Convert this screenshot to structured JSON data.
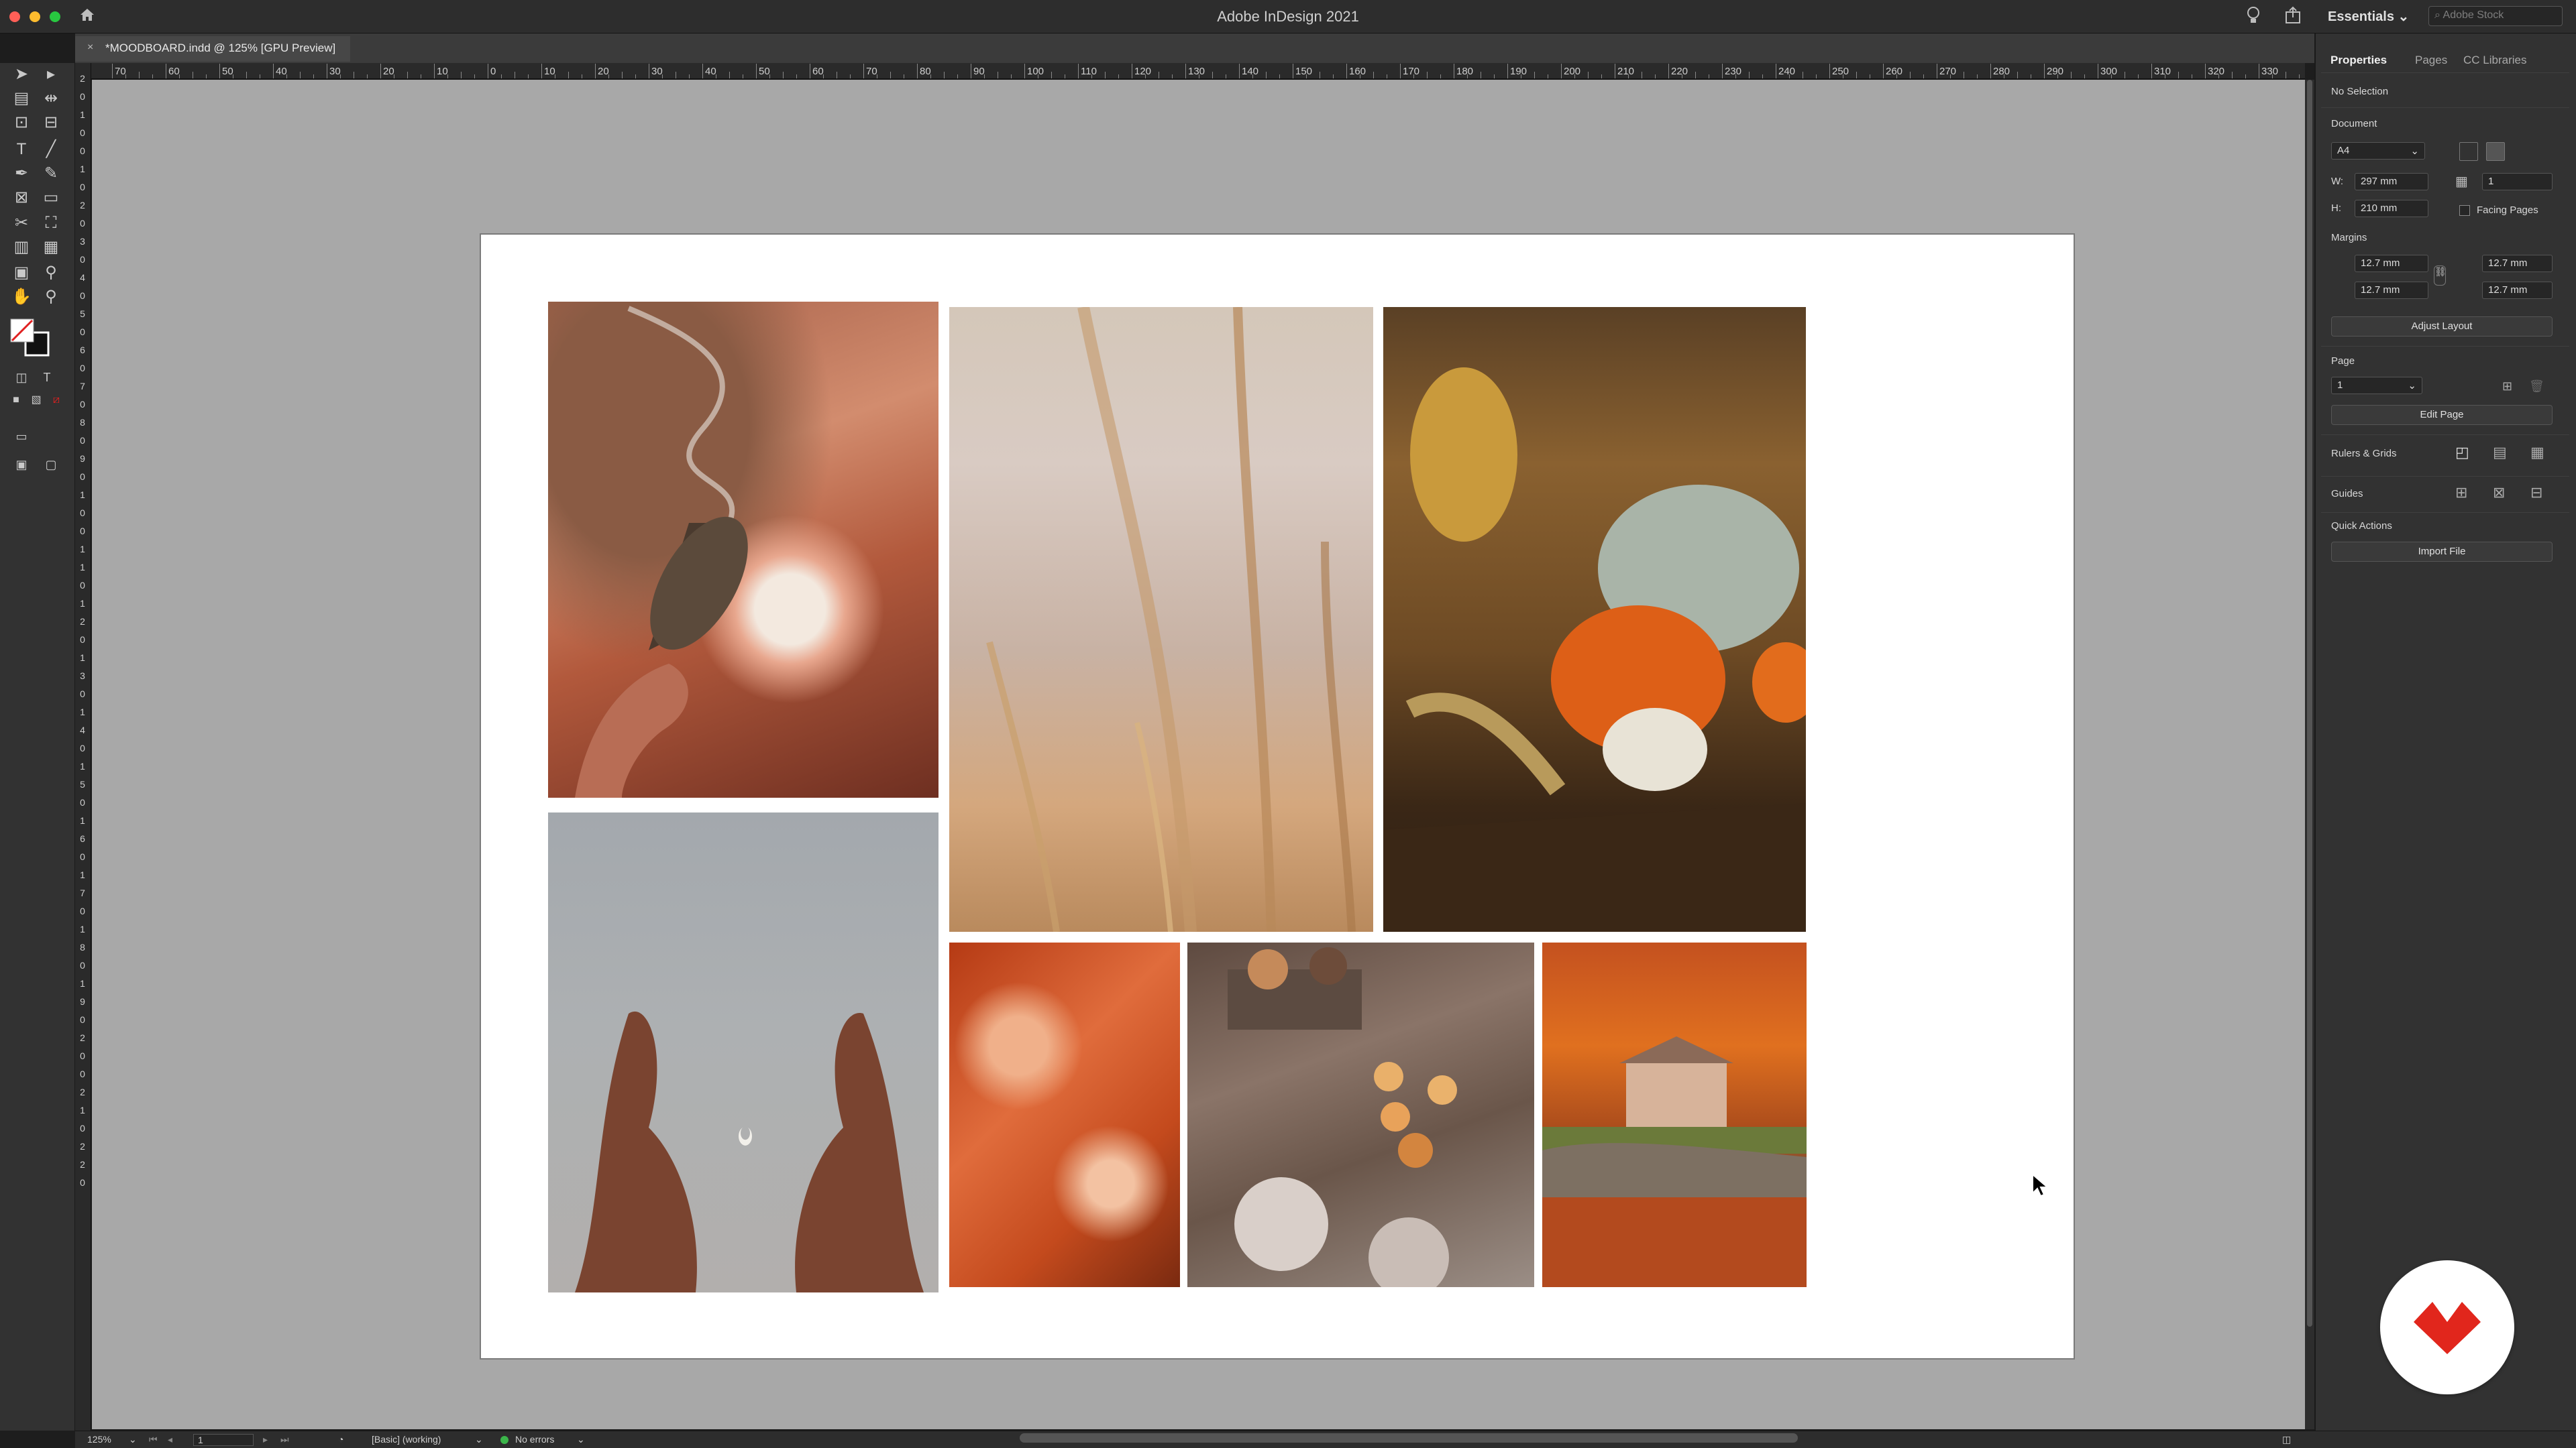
{
  "window": {
    "app_title": "Adobe InDesign 2021",
    "workspace": "Essentials",
    "stock_search_placeholder": "Adobe Stock"
  },
  "document_tab": {
    "close_glyph": "×",
    "label": "*MOODBOARD.indd @ 125% [GPU Preview]"
  },
  "ruler_horizontal": [
    "70",
    "60",
    "50",
    "40",
    "30",
    "20",
    "10",
    "0",
    "10",
    "20",
    "30",
    "40",
    "50",
    "60",
    "70",
    "80",
    "90",
    "100",
    "110",
    "120",
    "130",
    "140",
    "150",
    "160",
    "170",
    "180",
    "190",
    "200",
    "210",
    "220",
    "230",
    "240",
    "250",
    "260",
    "270",
    "280",
    "290",
    "300",
    "310",
    "320",
    "330"
  ],
  "ruler_vertical": [
    "2",
    "0",
    "1",
    "0",
    "0",
    "1",
    "0",
    "2",
    "0",
    "3",
    "0",
    "4",
    "0",
    "5",
    "0",
    "6",
    "0",
    "7",
    "0",
    "8",
    "0",
    "9",
    "0",
    "1",
    "0",
    "0",
    "1",
    "1",
    "0",
    "1",
    "2",
    "0",
    "1",
    "3",
    "0",
    "1",
    "4",
    "0",
    "1",
    "5",
    "0",
    "1",
    "6",
    "0",
    "1",
    "7",
    "0",
    "1",
    "8",
    "0",
    "1",
    "9",
    "0",
    "2",
    "0",
    "0",
    "2",
    "1",
    "0",
    "2",
    "2",
    "0"
  ],
  "moodboard": {
    "photos": [
      {
        "name": "photo-sage-smudge",
        "subject": "hand holding smoking sage bundle"
      },
      {
        "name": "photo-wheat-grass",
        "subject": "soft focus dry grass"
      },
      {
        "name": "photo-pumpkins",
        "subject": "pumpkins and autumn leaves"
      },
      {
        "name": "photo-hands-moon",
        "subject": "hands framing crescent moon"
      },
      {
        "name": "photo-autumn-leaves",
        "subject": "orange autumn leaves"
      },
      {
        "name": "photo-candles",
        "subject": "candles on books with cotton"
      },
      {
        "name": "photo-house-autumn",
        "subject": "house behind autumn trees"
      }
    ],
    "swatches": [
      "#c2c6a7",
      "#9fa07c",
      "#9a620f",
      "#dd6a15",
      "#e6a64d"
    ]
  },
  "properties_panel": {
    "tabs": [
      "Properties",
      "Pages",
      "CC Libraries"
    ],
    "selection_status": "No Selection",
    "document_section": "Document",
    "page_size": "A4",
    "width_label": "W:",
    "width_value": "297 mm",
    "height_label": "H:",
    "height_value": "210 mm",
    "pages_count": "1",
    "facing_pages_label": "Facing Pages",
    "margins_section": "Margins",
    "margin_top": "12.7 mm",
    "margin_bottom": "12.7 mm",
    "margin_left": "12.7 mm",
    "margin_right": "12.7 mm",
    "adjust_layout": "Adjust Layout",
    "page_section": "Page",
    "page_value": "1",
    "edit_page": "Edit Page",
    "rulers_grids": "Rulers & Grids",
    "guides": "Guides",
    "quick_actions": "Quick Actions",
    "import_file": "Import File"
  },
  "status_bar": {
    "zoom": "125%",
    "page": "1",
    "preflight_profile": "[Basic] (working)",
    "errors": "No errors"
  },
  "colors": {
    "error_indicator": "#3bb54a",
    "logo_red": "#e1261c",
    "fill_swatch_stroke": "#e02020"
  }
}
